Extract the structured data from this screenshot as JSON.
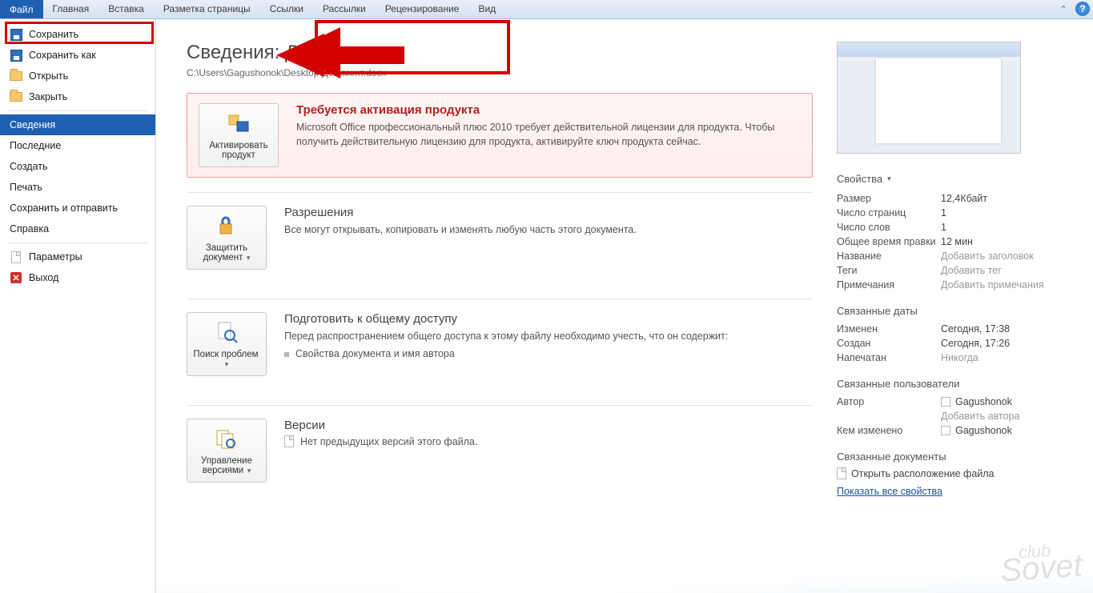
{
  "ribbon": {
    "tabs": [
      "Файл",
      "Главная",
      "Вставка",
      "Разметка страницы",
      "Ссылки",
      "Рассылки",
      "Рецензирование",
      "Вид"
    ],
    "active": 0
  },
  "sidebar": {
    "items": [
      {
        "label": "Сохранить",
        "icon": "disk"
      },
      {
        "label": "Сохранить как",
        "icon": "disk"
      },
      {
        "label": "Открыть",
        "icon": "folder"
      },
      {
        "label": "Закрыть",
        "icon": "folder"
      }
    ],
    "items2": [
      {
        "label": "Сведения",
        "selected": true
      },
      {
        "label": "Последние"
      },
      {
        "label": "Создать"
      },
      {
        "label": "Печать"
      },
      {
        "label": "Сохранить и отправить"
      },
      {
        "label": "Справка"
      }
    ],
    "items3": [
      {
        "label": "Параметры",
        "icon": "page"
      },
      {
        "label": "Выход",
        "icon": "x"
      }
    ]
  },
  "page": {
    "title": "Сведения: Документ",
    "path": "C:\\Users\\Gagushonok\\Desktop\\Документ.docx"
  },
  "activation": {
    "btn": "Активировать продукт",
    "title": "Требуется активация продукта",
    "text": "Microsoft Office профессиональный плюс 2010 требует действительной лицензии для продукта. Чтобы получить действительную лицензию для продукта, активируйте ключ продукта сейчас."
  },
  "permissions": {
    "btn": "Защитить документ",
    "title": "Разрешения",
    "text": "Все могут открывать, копировать и изменять любую часть этого документа."
  },
  "prepare": {
    "btn": "Поиск проблем",
    "title": "Подготовить к общему доступу",
    "text": "Перед распространением общего доступа к этому файлу необходимо учесть, что он содержит:",
    "bullet": "Свойства документа и имя автора"
  },
  "versions": {
    "btn": "Управление версиями",
    "title": "Версии",
    "text": "Нет предыдущих версий этого файла."
  },
  "props": {
    "header": "Свойства",
    "rows": [
      {
        "k": "Размер",
        "v": "12,4Кбайт"
      },
      {
        "k": "Число страниц",
        "v": "1"
      },
      {
        "k": "Число слов",
        "v": "1"
      },
      {
        "k": "Общее время правки",
        "v": "12 мин"
      },
      {
        "k": "Название",
        "v": "Добавить заголовок",
        "ph": true
      },
      {
        "k": "Теги",
        "v": "Добавить тег",
        "ph": true
      },
      {
        "k": "Примечания",
        "v": "Добавить примечания",
        "ph": true
      }
    ],
    "datesHeader": "Связанные даты",
    "dates": [
      {
        "k": "Изменен",
        "v": "Сегодня, 17:38"
      },
      {
        "k": "Создан",
        "v": "Сегодня, 17:26"
      },
      {
        "k": "Напечатан",
        "v": "Никогда",
        "ph": true
      }
    ],
    "peopleHeader": "Связанные пользователи",
    "author_k": "Автор",
    "author_v": "Gagushonok",
    "addAuthor": "Добавить автора",
    "modby_k": "Кем изменено",
    "modby_v": "Gagushonok",
    "docsHeader": "Связанные документы",
    "openLocation": "Открыть расположение файла",
    "showAll": "Показать все свойства"
  },
  "watermark": "Sovet"
}
